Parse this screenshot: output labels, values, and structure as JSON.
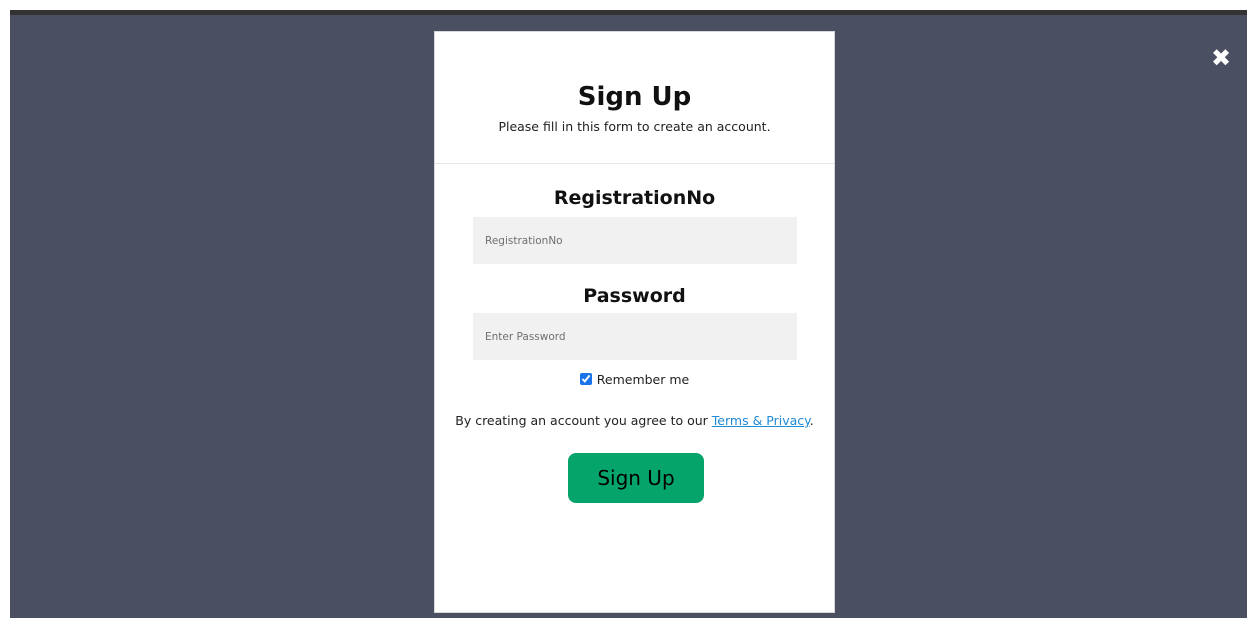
{
  "modal": {
    "title": "Sign Up",
    "subtitle": "Please fill in this form to create an account.",
    "registration": {
      "label": "RegistrationNo",
      "placeholder": "RegistrationNo",
      "value": ""
    },
    "password": {
      "label": "Password",
      "placeholder": "Enter Password",
      "value": ""
    },
    "remember": {
      "label": "Remember me",
      "checked": true
    },
    "terms": {
      "prefix": "By creating an account you agree to our ",
      "link_text": "Terms & Privacy",
      "suffix": "."
    },
    "submit_label": "Sign Up"
  },
  "close_icon": "close-icon",
  "colors": {
    "overlay": "#4a5061",
    "button": "#04a46a",
    "link": "#1f8ad6",
    "input_bg": "#f1f1f1"
  }
}
